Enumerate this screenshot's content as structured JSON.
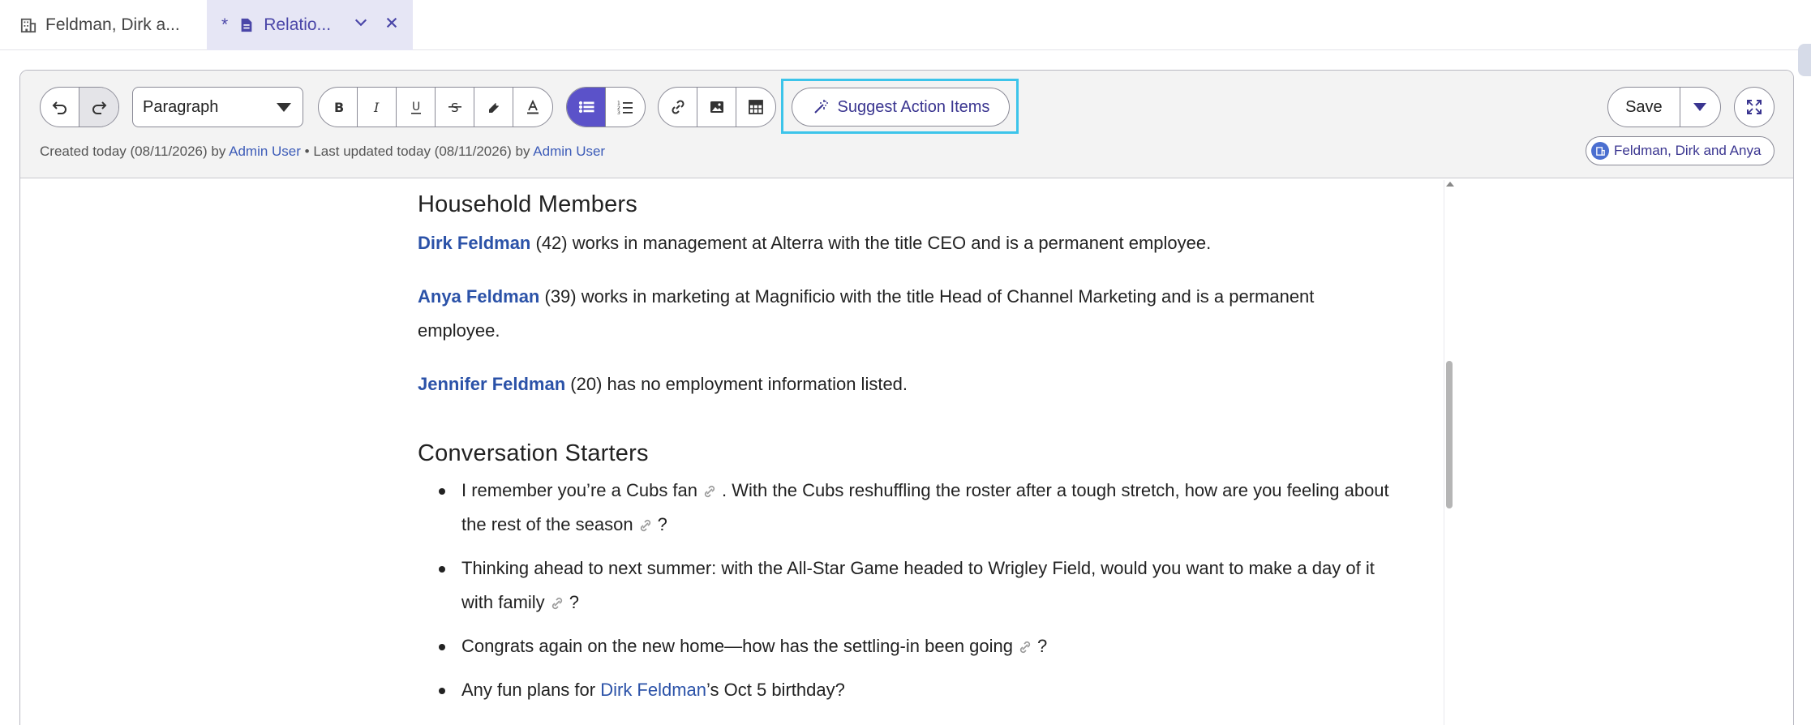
{
  "tabs": [
    {
      "label": "Feldman, Dirk a...",
      "icon": "building-icon"
    },
    {
      "label": "Relatio...",
      "modified_marker": "*",
      "icon": "document-icon"
    }
  ],
  "toolbar": {
    "block_format": "Paraph",
    "block_format_full": "Paragraph",
    "suggest_label": "Suggest Action Items",
    "save_label": "Save"
  },
  "meta": {
    "created_prefix": "Created today (08/11/2026) by ",
    "created_by": "Admin User",
    "separator": " • Last updated today (08/11/2026) by ",
    "updated_by": "Admin User"
  },
  "related_chip": "Feldman, Dirk and Anya",
  "content": {
    "heading_household": "Household Members",
    "members": [
      {
        "name": "Dirk Feldman",
        "text": " (42) works in management at Alterra with the title CEO and is a permanent employee."
      },
      {
        "name": "Anya Feldman",
        "text": " (39) works in marketing at Magnificio with the title Head of Channel Marketing and is a permanent employee."
      },
      {
        "name": "Jennifer Feldman",
        "text": " (20) has no employment information listed."
      }
    ],
    "heading_starters": "Conversation Starters",
    "starters": {
      "s1a": "I remember you’re a Cubs fan",
      "s1b": ". With the Cubs reshuffling the roster after a tough stretch, how are you feeling about the rest of the season",
      "s1c": "?",
      "s2a": "Thinking ahead to next summer: with the All-Star Game headed to Wrigley Field, would you want to make a day of it with family",
      "s2b": "?",
      "s3a": "Congrats again on the new home—how has the settling-in been going",
      "s3b": "?",
      "s4a": "Any fun plans for ",
      "s4link": "Dirk Feldman",
      "s4b": "’s Oct 5 birthday?"
    }
  },
  "colors": {
    "accent": "#5b52c9",
    "link": "#2b52a8",
    "highlight_border": "#3cc4ea",
    "active_tab_bg": "#e6e6f5"
  }
}
